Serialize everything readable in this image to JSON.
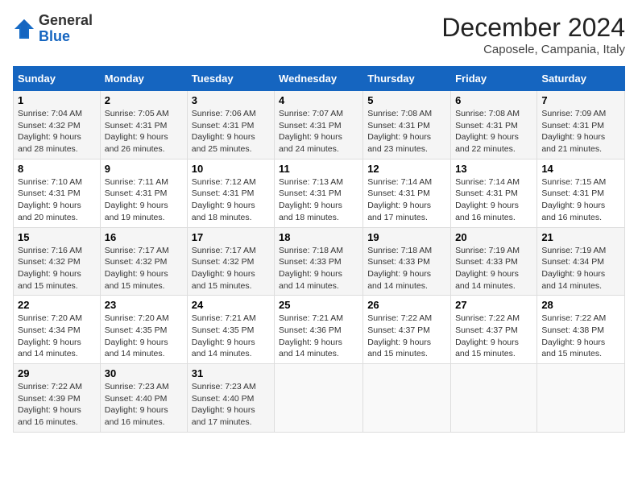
{
  "logo": {
    "general": "General",
    "blue": "Blue"
  },
  "header": {
    "month": "December 2024",
    "location": "Caposele, Campania, Italy"
  },
  "weekdays": [
    "Sunday",
    "Monday",
    "Tuesday",
    "Wednesday",
    "Thursday",
    "Friday",
    "Saturday"
  ],
  "weeks": [
    [
      {
        "day": "1",
        "sunrise": "7:04 AM",
        "sunset": "4:32 PM",
        "daylight": "9 hours and 28 minutes."
      },
      {
        "day": "2",
        "sunrise": "7:05 AM",
        "sunset": "4:31 PM",
        "daylight": "9 hours and 26 minutes."
      },
      {
        "day": "3",
        "sunrise": "7:06 AM",
        "sunset": "4:31 PM",
        "daylight": "9 hours and 25 minutes."
      },
      {
        "day": "4",
        "sunrise": "7:07 AM",
        "sunset": "4:31 PM",
        "daylight": "9 hours and 24 minutes."
      },
      {
        "day": "5",
        "sunrise": "7:08 AM",
        "sunset": "4:31 PM",
        "daylight": "9 hours and 23 minutes."
      },
      {
        "day": "6",
        "sunrise": "7:08 AM",
        "sunset": "4:31 PM",
        "daylight": "9 hours and 22 minutes."
      },
      {
        "day": "7",
        "sunrise": "7:09 AM",
        "sunset": "4:31 PM",
        "daylight": "9 hours and 21 minutes."
      }
    ],
    [
      {
        "day": "8",
        "sunrise": "7:10 AM",
        "sunset": "4:31 PM",
        "daylight": "9 hours and 20 minutes."
      },
      {
        "day": "9",
        "sunrise": "7:11 AM",
        "sunset": "4:31 PM",
        "daylight": "9 hours and 19 minutes."
      },
      {
        "day": "10",
        "sunrise": "7:12 AM",
        "sunset": "4:31 PM",
        "daylight": "9 hours and 18 minutes."
      },
      {
        "day": "11",
        "sunrise": "7:13 AM",
        "sunset": "4:31 PM",
        "daylight": "9 hours and 18 minutes."
      },
      {
        "day": "12",
        "sunrise": "7:14 AM",
        "sunset": "4:31 PM",
        "daylight": "9 hours and 17 minutes."
      },
      {
        "day": "13",
        "sunrise": "7:14 AM",
        "sunset": "4:31 PM",
        "daylight": "9 hours and 16 minutes."
      },
      {
        "day": "14",
        "sunrise": "7:15 AM",
        "sunset": "4:31 PM",
        "daylight": "9 hours and 16 minutes."
      }
    ],
    [
      {
        "day": "15",
        "sunrise": "7:16 AM",
        "sunset": "4:32 PM",
        "daylight": "9 hours and 15 minutes."
      },
      {
        "day": "16",
        "sunrise": "7:17 AM",
        "sunset": "4:32 PM",
        "daylight": "9 hours and 15 minutes."
      },
      {
        "day": "17",
        "sunrise": "7:17 AM",
        "sunset": "4:32 PM",
        "daylight": "9 hours and 15 minutes."
      },
      {
        "day": "18",
        "sunrise": "7:18 AM",
        "sunset": "4:33 PM",
        "daylight": "9 hours and 14 minutes."
      },
      {
        "day": "19",
        "sunrise": "7:18 AM",
        "sunset": "4:33 PM",
        "daylight": "9 hours and 14 minutes."
      },
      {
        "day": "20",
        "sunrise": "7:19 AM",
        "sunset": "4:33 PM",
        "daylight": "9 hours and 14 minutes."
      },
      {
        "day": "21",
        "sunrise": "7:19 AM",
        "sunset": "4:34 PM",
        "daylight": "9 hours and 14 minutes."
      }
    ],
    [
      {
        "day": "22",
        "sunrise": "7:20 AM",
        "sunset": "4:34 PM",
        "daylight": "9 hours and 14 minutes."
      },
      {
        "day": "23",
        "sunrise": "7:20 AM",
        "sunset": "4:35 PM",
        "daylight": "9 hours and 14 minutes."
      },
      {
        "day": "24",
        "sunrise": "7:21 AM",
        "sunset": "4:35 PM",
        "daylight": "9 hours and 14 minutes."
      },
      {
        "day": "25",
        "sunrise": "7:21 AM",
        "sunset": "4:36 PM",
        "daylight": "9 hours and 14 minutes."
      },
      {
        "day": "26",
        "sunrise": "7:22 AM",
        "sunset": "4:37 PM",
        "daylight": "9 hours and 15 minutes."
      },
      {
        "day": "27",
        "sunrise": "7:22 AM",
        "sunset": "4:37 PM",
        "daylight": "9 hours and 15 minutes."
      },
      {
        "day": "28",
        "sunrise": "7:22 AM",
        "sunset": "4:38 PM",
        "daylight": "9 hours and 15 minutes."
      }
    ],
    [
      {
        "day": "29",
        "sunrise": "7:22 AM",
        "sunset": "4:39 PM",
        "daylight": "9 hours and 16 minutes."
      },
      {
        "day": "30",
        "sunrise": "7:23 AM",
        "sunset": "4:40 PM",
        "daylight": "9 hours and 16 minutes."
      },
      {
        "day": "31",
        "sunrise": "7:23 AM",
        "sunset": "4:40 PM",
        "daylight": "9 hours and 17 minutes."
      },
      null,
      null,
      null,
      null
    ]
  ],
  "labels": {
    "sunrise": "Sunrise:",
    "sunset": "Sunset:",
    "daylight": "Daylight:"
  }
}
